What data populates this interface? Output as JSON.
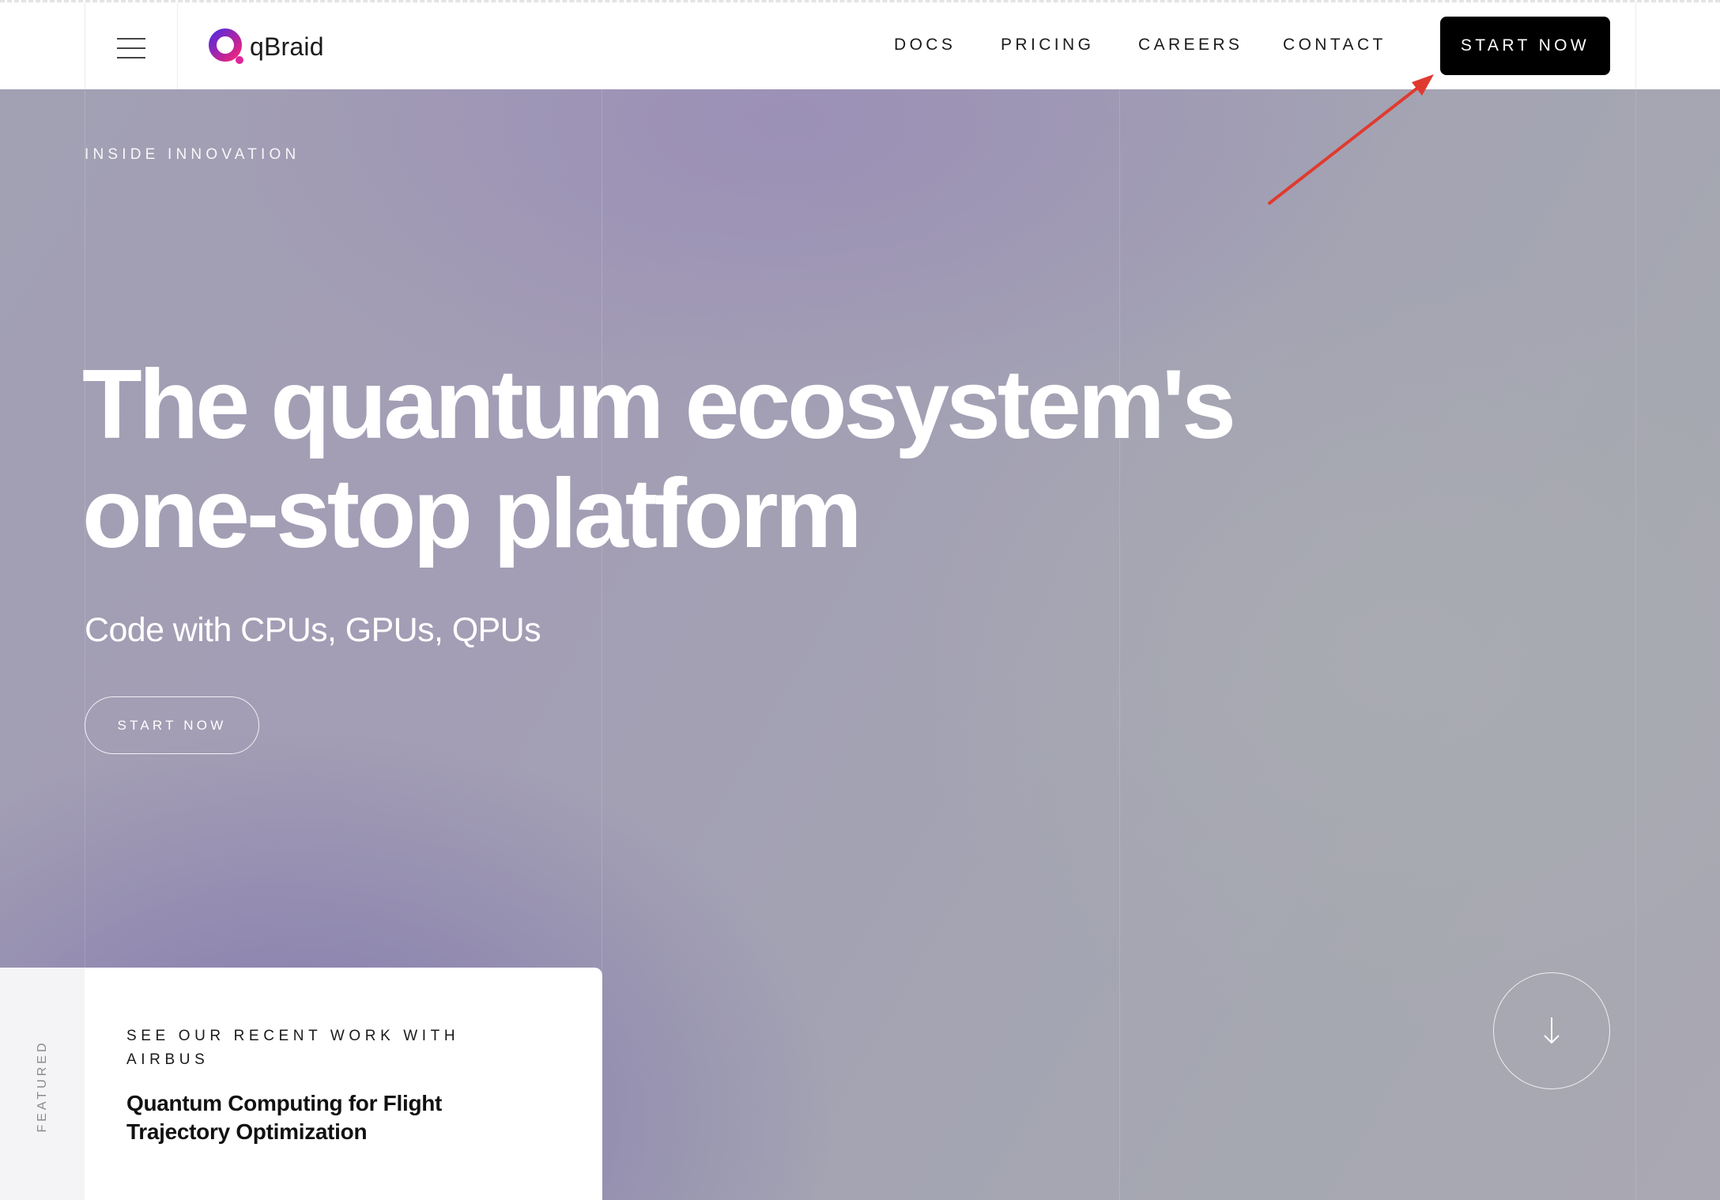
{
  "header": {
    "brand": "qBraid",
    "nav": [
      {
        "label": "DOCS"
      },
      {
        "label": "PRICING"
      },
      {
        "label": "CAREERS"
      },
      {
        "label": "CONTACT"
      }
    ],
    "cta_label": "START NOW",
    "icons": {
      "menu": "hamburger-menu-icon",
      "logo": "qbraid-logo-icon"
    }
  },
  "hero": {
    "eyebrow": "INSIDE INNOVATION",
    "headline_line1": "The quantum ecosystem's",
    "headline_line2": "one-stop platform",
    "subheadline": "Code with CPUs, GPUs, QPUs",
    "cta_label": "START NOW",
    "scroll_icon": "arrow-down-icon"
  },
  "featured": {
    "side_label": "FEATURED",
    "eyebrow": "SEE OUR RECENT WORK WITH AIRBUS",
    "title": "Quantum Computing for Flight Trajectory Optimization"
  },
  "colors": {
    "accent_button": "#000000",
    "annotation_arrow": "#e03a2f",
    "logo_gradient_start": "#6a2bd9",
    "logo_gradient_end": "#e0269c"
  }
}
